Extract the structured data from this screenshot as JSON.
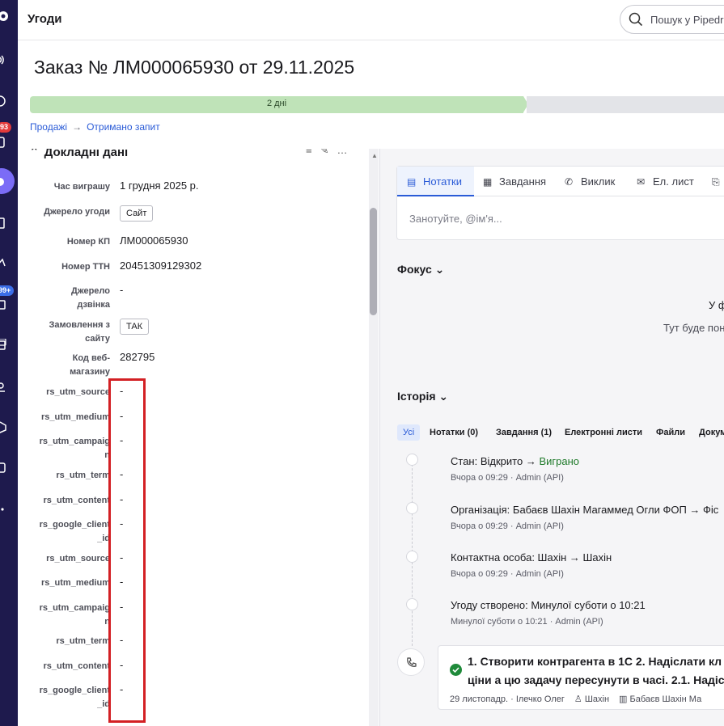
{
  "app": {
    "section_title": "Угоди",
    "search_placeholder": "Пошук у Pipedri"
  },
  "rail": {
    "badge_deals": "93",
    "badge_mail": "99+"
  },
  "deal": {
    "title": "Заказ № ЛМ000065930 от 29.11.2025",
    "stage_label": "2 дні",
    "stage_progress_fraction": 0.7,
    "breadcrumb": [
      "Продажі",
      "Отримано запит"
    ]
  },
  "details": {
    "heading": "Докладні дані",
    "fields": [
      {
        "label": "Час вигрaшу",
        "value": "1 грудня 2025 р."
      },
      {
        "label": "Джерело угоди",
        "value": "Сайт",
        "pill": true
      },
      {
        "label": "Номер КП",
        "value": "ЛМ000065930"
      },
      {
        "label": "Номер ТТН",
        "value": "20451309129302"
      },
      {
        "label": "Джерело дзвінка",
        "value": "-"
      },
      {
        "label": "Замовлення з сайту",
        "value": "ТАК",
        "pill": true
      },
      {
        "label": "Код веб-магазину",
        "value": "282795"
      },
      {
        "label": "rs_utm_source",
        "value": "-"
      },
      {
        "label": "rs_utm_medium",
        "value": "-"
      },
      {
        "label": "rs_utm_campaign",
        "value": "-"
      },
      {
        "label": "rs_utm_term",
        "value": "-"
      },
      {
        "label": "rs_utm_content",
        "value": "-"
      },
      {
        "label": "rs_google_client_id",
        "value": "-"
      },
      {
        "label": "rs_utm_source",
        "value": "-"
      },
      {
        "label": "rs_utm_medium",
        "value": "-"
      },
      {
        "label": "rs_utm_campaign",
        "value": "-"
      },
      {
        "label": "rs_utm_term",
        "value": "-"
      },
      {
        "label": "rs_utm_content",
        "value": "-"
      },
      {
        "label": "rs_google_client_id",
        "value": "-"
      }
    ]
  },
  "composer": {
    "tabs": [
      "Нотатки",
      "Завдання",
      "Виклик",
      "Ел. лист"
    ],
    "placeholder": "Занотуйте, @ім'я..."
  },
  "focus": {
    "heading": "Фокус",
    "line1": "У ф",
    "line2": "Тут буде пон"
  },
  "history": {
    "heading": "Історія",
    "filters": [
      "Усі",
      "Нотатки (0)",
      "Завдання (1)",
      "Електронні листи",
      "Файли",
      "Докум"
    ],
    "events": [
      {
        "label": "Стан",
        "from": "Відкрито",
        "to": "Виграно",
        "meta": "Вчора о 09:29 · Admin (API)"
      },
      {
        "label": "Організація",
        "from": "Бабаєв Шахін Магаммед Огли ФОП",
        "to": "Фіс",
        "meta": "Вчора о 09:29 · Admin (API)"
      },
      {
        "label": "Контактна особа",
        "from": "Шахін",
        "to": "Шахін",
        "meta": "Вчора о 09:29 · Admin (API)"
      },
      {
        "label": "Угоду створено",
        "from": "Минулої суботи о 10:21",
        "to": "",
        "meta": "Минулої суботи о 10:21 · Admin (API)"
      }
    ],
    "task": {
      "line1": "1. Створити контрагента в 1С 2. Надіслати кл",
      "line2": "ціни а цю задачу пересунути в часі. 2.1. Надіс",
      "date": "29 листопадр. · Ілечко Олег",
      "person": "Шахін",
      "org": "Бабаєв Шахін Ма"
    }
  }
}
